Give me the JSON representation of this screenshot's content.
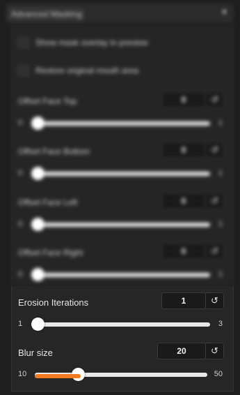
{
  "accordion": {
    "title": "Advanced Masking",
    "caret": "▼"
  },
  "checkboxes": [
    {
      "label": "Show mask overlay in preview",
      "checked": false
    },
    {
      "label": "Restore original mouth area",
      "checked": false
    }
  ],
  "sliders": [
    {
      "label": "Offset Face Top",
      "value": "0",
      "min": "0",
      "max": "1",
      "fraction": 0.0
    },
    {
      "label": "Offset Face Bottom",
      "value": "0",
      "min": "0",
      "max": "1",
      "fraction": 0.0
    },
    {
      "label": "Offset Face Left",
      "value": "0",
      "min": "0",
      "max": "1",
      "fraction": 0.0
    },
    {
      "label": "Offset Face Right",
      "value": "0",
      "min": "0",
      "max": "1",
      "fraction": 0.0
    },
    {
      "label": "Erosion Iterations",
      "value": "1",
      "min": "1",
      "max": "3",
      "fraction": 0.0
    },
    {
      "label": "Blur size",
      "value": "20",
      "min": "10",
      "max": "50",
      "fraction": 0.25
    }
  ],
  "reset_glyph": "↺",
  "colors": {
    "accent": "#f47a1f",
    "track": "#e7e7e7",
    "panel": "#262626"
  }
}
